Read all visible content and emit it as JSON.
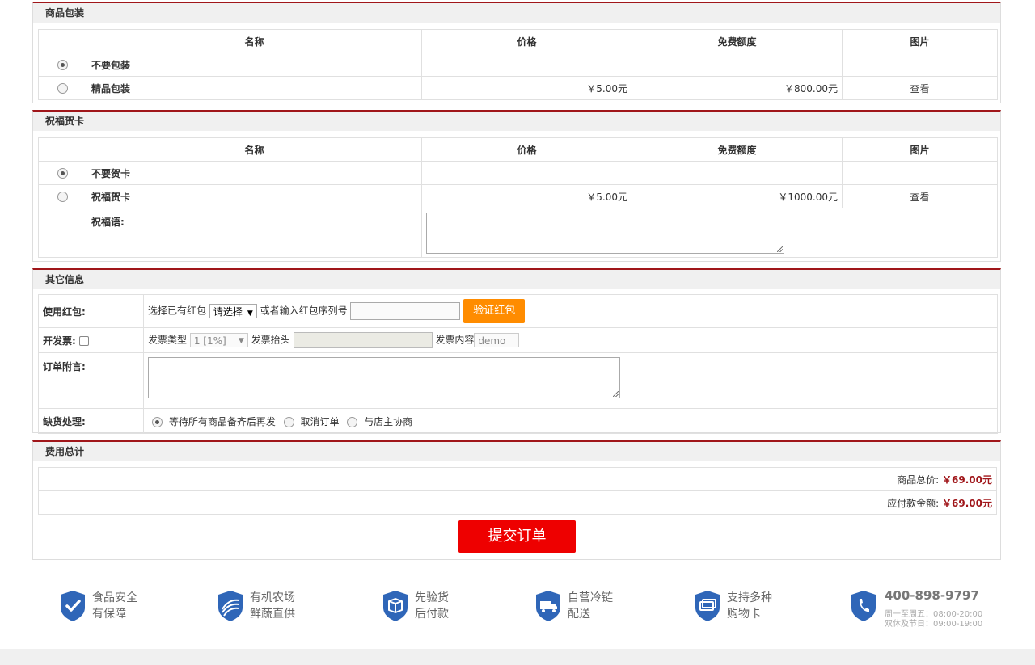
{
  "packaging": {
    "title": "商品包装",
    "headers": [
      "名称",
      "价格",
      "免费额度",
      "图片"
    ],
    "rows": [
      {
        "name": "不要包装",
        "price": "",
        "free": "",
        "image": "",
        "selected": true
      },
      {
        "name": "精品包装",
        "price": "￥5.00元",
        "free": "￥800.00元",
        "image": "查看",
        "selected": false
      }
    ]
  },
  "card": {
    "title": "祝福贺卡",
    "headers": [
      "名称",
      "价格",
      "免费额度",
      "图片"
    ],
    "rows": [
      {
        "name": "不要贺卡",
        "price": "",
        "free": "",
        "image": "",
        "selected": true
      },
      {
        "name": "祝福贺卡",
        "price": "￥5.00元",
        "free": "￥1000.00元",
        "image": "查看",
        "selected": false
      }
    ],
    "message_label": "祝福语:"
  },
  "other": {
    "title": "其它信息",
    "bonus_label": "使用红包:",
    "bonus_select_prefix": "选择已有红包",
    "bonus_select_value": "请选择",
    "bonus_or_text": "或者输入红包序列号",
    "bonus_verify_button": "验证红包",
    "invoice_label": "开发票:",
    "invoice_type_label": "发票类型",
    "invoice_type_value": "1 [1%]",
    "invoice_title_label": "发票抬头",
    "invoice_content_label": "发票内容",
    "invoice_content_value": "demo",
    "note_label": "订单附言:",
    "shortage_label": "缺货处理:",
    "shortage_options": [
      {
        "label": "等待所有商品备齐后再发",
        "selected": true
      },
      {
        "label": "取消订单",
        "selected": false
      },
      {
        "label": "与店主协商",
        "selected": false
      }
    ]
  },
  "total": {
    "title": "费用总计",
    "goods_total_label": "商品总价:",
    "goods_total_value": "￥69.00元",
    "payable_label": "应付款金额:",
    "payable_value": "￥69.00元",
    "submit_label": "提交订单"
  },
  "features": [
    {
      "icon": "check-shield-icon",
      "line1": "食品安全",
      "line2": "有保障"
    },
    {
      "icon": "farm-shield-icon",
      "line1": "有机农场",
      "line2": "鲜蔬直供"
    },
    {
      "icon": "box-shield-icon",
      "line1": "先验货",
      "line2": "后付款"
    },
    {
      "icon": "truck-shield-icon",
      "line1": "自营冷链",
      "line2": "配送"
    },
    {
      "icon": "card-shield-icon",
      "line1": "支持多种",
      "line2": "购物卡"
    }
  ],
  "hotline": {
    "icon": "phone-shield-icon",
    "number": "400-898-9797",
    "hours1": "周一至周五：08:00-20:00",
    "hours2": "双休及节日：09:00-19:00"
  },
  "colors": {
    "accent": "#a0161a",
    "submit": "#ee0000",
    "verify": "#ff8c00",
    "shield": "#2f66b8"
  }
}
